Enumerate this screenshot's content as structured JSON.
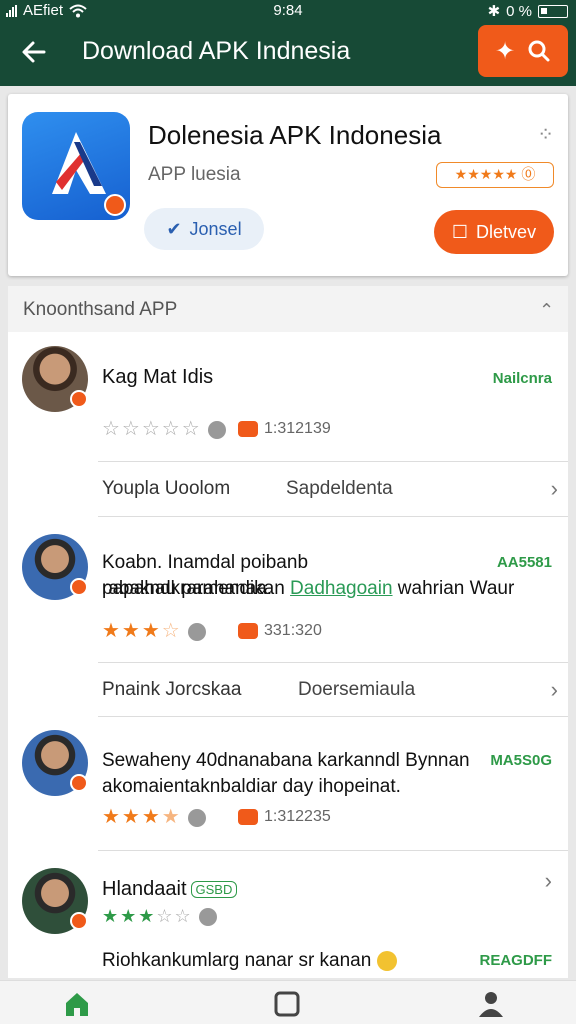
{
  "status_bar": {
    "carrier": "AEfiet",
    "time": "9:84",
    "battery": "0 %",
    "icons": [
      "signal-icon",
      "wifi-icon",
      "bluetooth-icon",
      "battery-icon"
    ]
  },
  "app_bar": {
    "title": "Download APK Indnesia",
    "back_icon": "back-arrow-icon",
    "action_icons": [
      "sparkle-icon",
      "search-icon"
    ]
  },
  "app_card": {
    "name": "Dolenesia APK Indonesia",
    "subtitle": "APP luesia",
    "rating_text": "★★★★★ ⓪",
    "join_label": "Jonsel",
    "download_label": "Dletvev"
  },
  "reviews_section": {
    "header": "Knoonthsand APP",
    "items": [
      {
        "name": "Kag Mat Idis",
        "tag": "Nailcnra",
        "stars": 0,
        "meta": "1:312139",
        "sub_left": "Youpla Uoolom",
        "sub_right": "Sapdeldenta"
      },
      {
        "name": "Koabn.",
        "text_1": "Inamdal poibanb rabakndkrarahanaa.",
        "text_2_before": "papahau pamendikan ",
        "text_2_link": "Dadhagoain",
        "text_2_after": " wahrian Waur",
        "tag": "AA5581",
        "stars": 3,
        "meta": "331:320",
        "sub_left": "Pnaink Jorcskaa",
        "sub_right": "Doersemiaula"
      },
      {
        "name": "",
        "text_1": "Sewaheny 40dnanabana karkanndl Bynnan",
        "text_2": "akomaientaknbaldiar day ihopeinat.",
        "tag": "MA5S0G",
        "stars": 3,
        "meta": "1:312235"
      },
      {
        "name": "Hlandaait",
        "badge": "GSBD",
        "stars": 3,
        "text_1": "Riohkankumlarg nanar sr kanan",
        "tag": "REAGDFF"
      }
    ]
  },
  "bottom_nav": {
    "items": [
      "home-icon",
      "square-icon",
      "profile-icon"
    ]
  },
  "colors": {
    "app_bar": "#174a36",
    "accent": "#f05a1a",
    "green": "#2e9a48"
  }
}
